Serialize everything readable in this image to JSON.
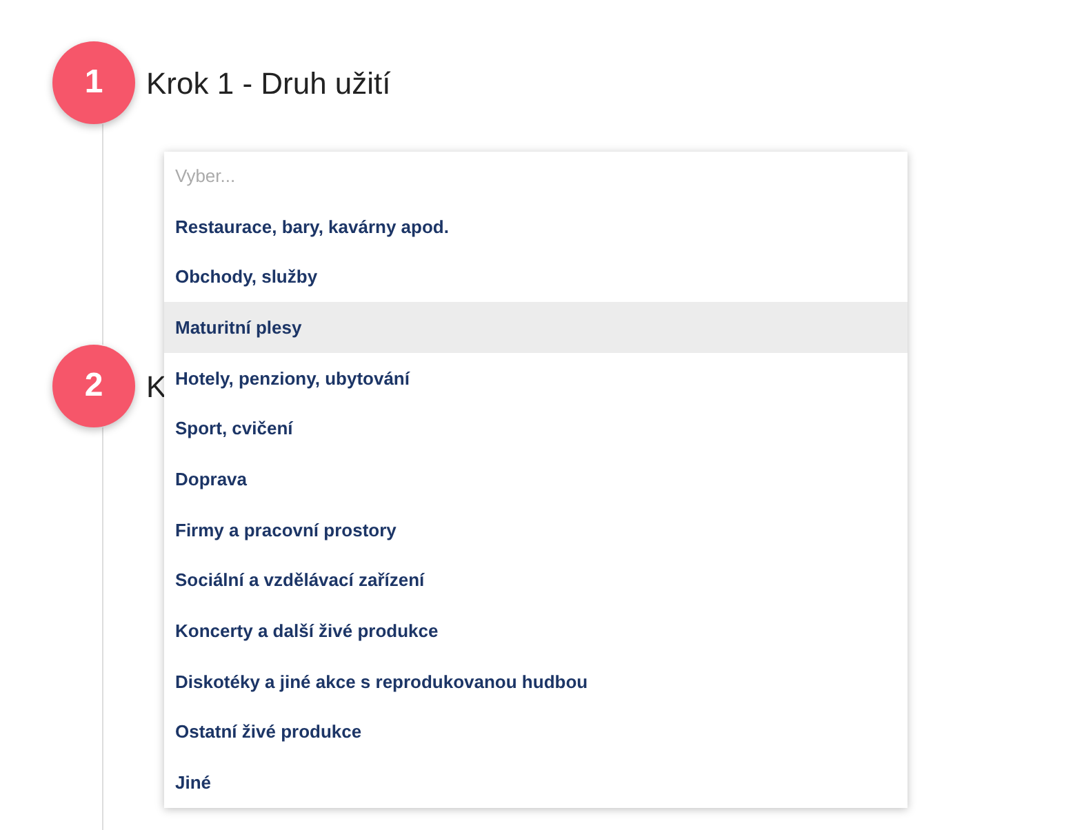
{
  "steps": [
    {
      "number": "1",
      "title": "Krok 1 - Druh užití"
    },
    {
      "number": "2",
      "title": "K"
    }
  ],
  "dropdown": {
    "placeholder": "Vyber...",
    "options": [
      {
        "label": "Restaurace, bary, kavárny apod.",
        "selected": false
      },
      {
        "label": "Obchody, služby",
        "selected": false
      },
      {
        "label": "Maturitní plesy",
        "selected": true
      },
      {
        "label": "Hotely, penziony, ubytování",
        "selected": false
      },
      {
        "label": "Sport, cvičení",
        "selected": false
      },
      {
        "label": "Doprava",
        "selected": false
      },
      {
        "label": "Firmy a pracovní prostory",
        "selected": false
      },
      {
        "label": "Sociální a vzdělávací zařízení",
        "selected": false
      },
      {
        "label": "Koncerty a další živé produkce",
        "selected": false
      },
      {
        "label": "Diskotéky a jiné akce s reprodukovanou hudbou",
        "selected": false
      },
      {
        "label": "Ostatní živé produkce",
        "selected": false
      },
      {
        "label": "Jiné",
        "selected": false
      }
    ]
  }
}
